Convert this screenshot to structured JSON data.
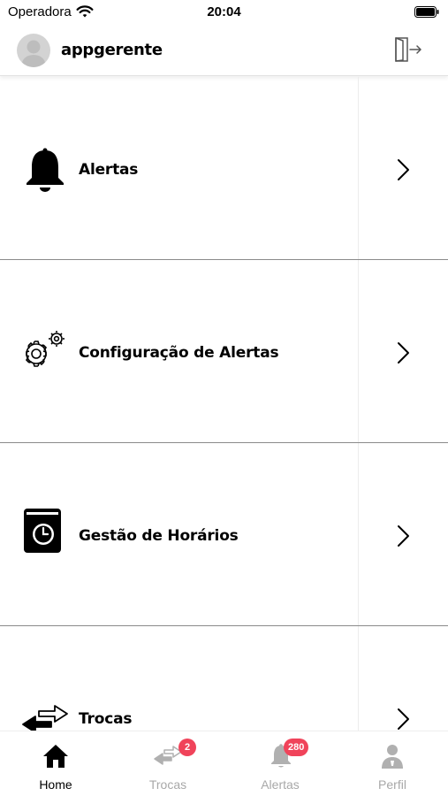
{
  "status_bar": {
    "carrier": "Operadora",
    "time": "20:04"
  },
  "header": {
    "username": "appgerente",
    "avatar_icon": "user-avatar-icon",
    "logout_icon": "logout-door-icon"
  },
  "menu": {
    "items": [
      {
        "label": "Alertas",
        "icon": "bell-icon"
      },
      {
        "label": "Configuração de Alertas",
        "icon": "gears-icon"
      },
      {
        "label": "Gestão de Horários",
        "icon": "clock-book-icon"
      },
      {
        "label": "Trocas",
        "icon": "swap-arrows-icon"
      }
    ],
    "chevron_icon": "chevron-right-icon"
  },
  "tabbar": {
    "tabs": [
      {
        "label": "Home",
        "icon": "home-icon",
        "active": true
      },
      {
        "label": "Trocas",
        "icon": "swap-arrows-icon",
        "badge": "2"
      },
      {
        "label": "Alertas",
        "icon": "bell-icon",
        "badge": "280"
      },
      {
        "label": "Perfil",
        "icon": "person-icon"
      }
    ]
  },
  "colors": {
    "badge": "#f0435a",
    "inactive_tab": "#a8a8a8",
    "active_tab": "#000000",
    "separator": "#8a8a8a"
  }
}
